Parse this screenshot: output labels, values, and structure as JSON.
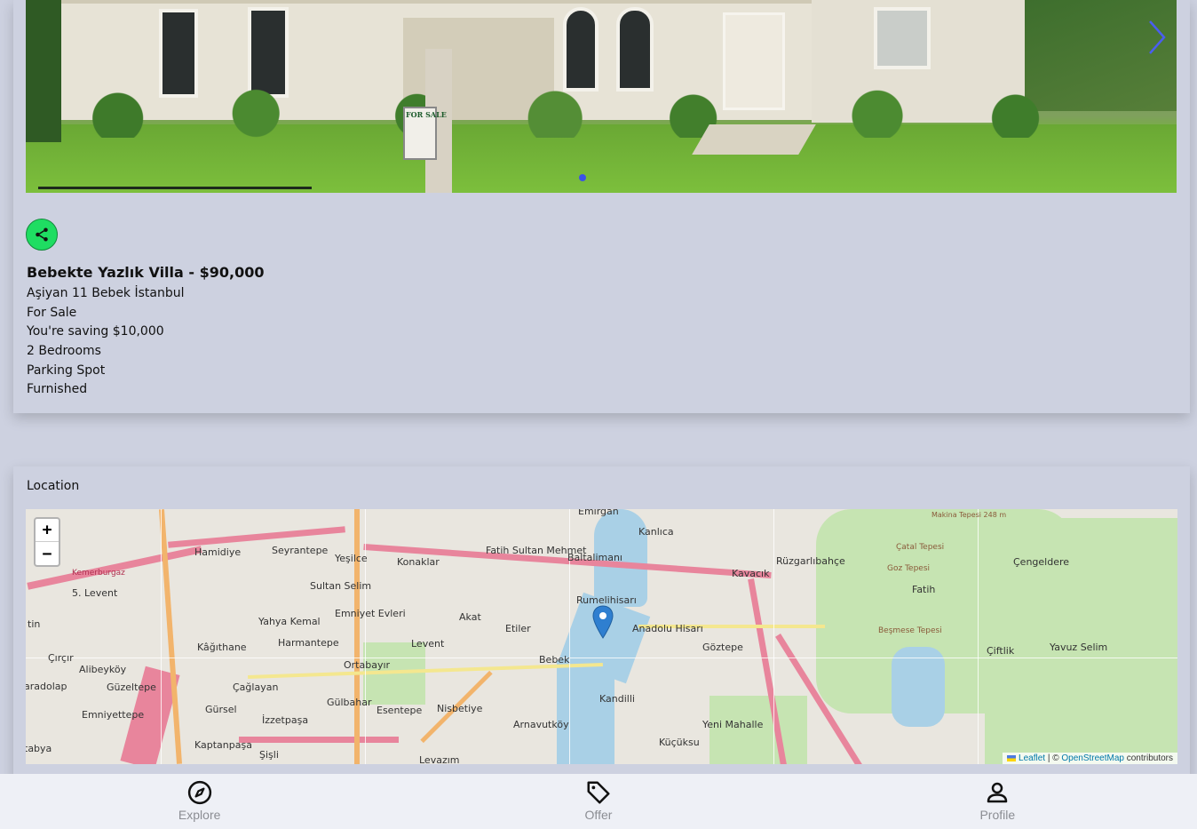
{
  "listing": {
    "title": "Bebekte Yazlık Villa - $90,000",
    "address": "Aşiyan 11 Bebek İstanbul",
    "status": "For Sale",
    "saving": "You're saving $10,000",
    "bedrooms": "2 Bedrooms",
    "parking": "Parking Spot",
    "furnished": "Furnished",
    "sign_text": "FOR SALE"
  },
  "carousel": {
    "next_icon": "chevron-right-icon",
    "dot_color": "#3b53e8"
  },
  "share": {
    "icon": "share-icon",
    "color": "#1fdd62"
  },
  "location": {
    "label": "Location",
    "map": {
      "zoom_in": "+",
      "zoom_out": "−",
      "marker_icon": "map-pin-icon",
      "attribution": {
        "leaflet": "Leaflet",
        "separator": "| ©",
        "osm": "OpenStreetMap",
        "suffix": "contributors"
      },
      "places": [
        "Emirgan",
        "Hamidiye",
        "Seyrantepe",
        "Yeşilce",
        "Konaklar",
        "Fatih Sultan Mehmet",
        "Baltalimanı",
        "Kanlıca",
        "Kavacık",
        "Rüzgarlıbahçe",
        "Çengeldere",
        "Kemerburgaz",
        "5. Levent",
        "Sultan Selim",
        "Emniyet Evleri",
        "Akat",
        "Etiler",
        "Rumelihisarı",
        "Anadolu Hisarı",
        "Göztepe",
        "Fatih",
        "Yahya Kemal",
        "Harmantepe",
        "Levent",
        "Kâğıthane",
        "Ortabayır",
        "Bebek",
        "Çiftlik",
        "Yavuz Selim",
        "Alibeyköy",
        "Güzeltepe",
        "Çağlayan",
        "Gürsel",
        "Gülbahar",
        "Esentepe",
        "Nisbetiye",
        "Kandilli",
        "Emniyettepe",
        "İzzetpaşa",
        "Arnavutköy",
        "Yeni Mahalle",
        "Kaptanpaşa",
        "Küçüksu",
        "Şişli",
        "Levazım",
        "Çatal Tepesi",
        "Goz Tepesi",
        "Beşmese Tepesi",
        "Makina Tepesi 248 m",
        "Çırçır",
        "aradolap",
        "tabya",
        "tin"
      ]
    }
  },
  "nav": [
    {
      "label": "Explore",
      "icon": "compass-icon"
    },
    {
      "label": "Offer",
      "icon": "tag-icon"
    },
    {
      "label": "Profile",
      "icon": "person-icon"
    }
  ]
}
